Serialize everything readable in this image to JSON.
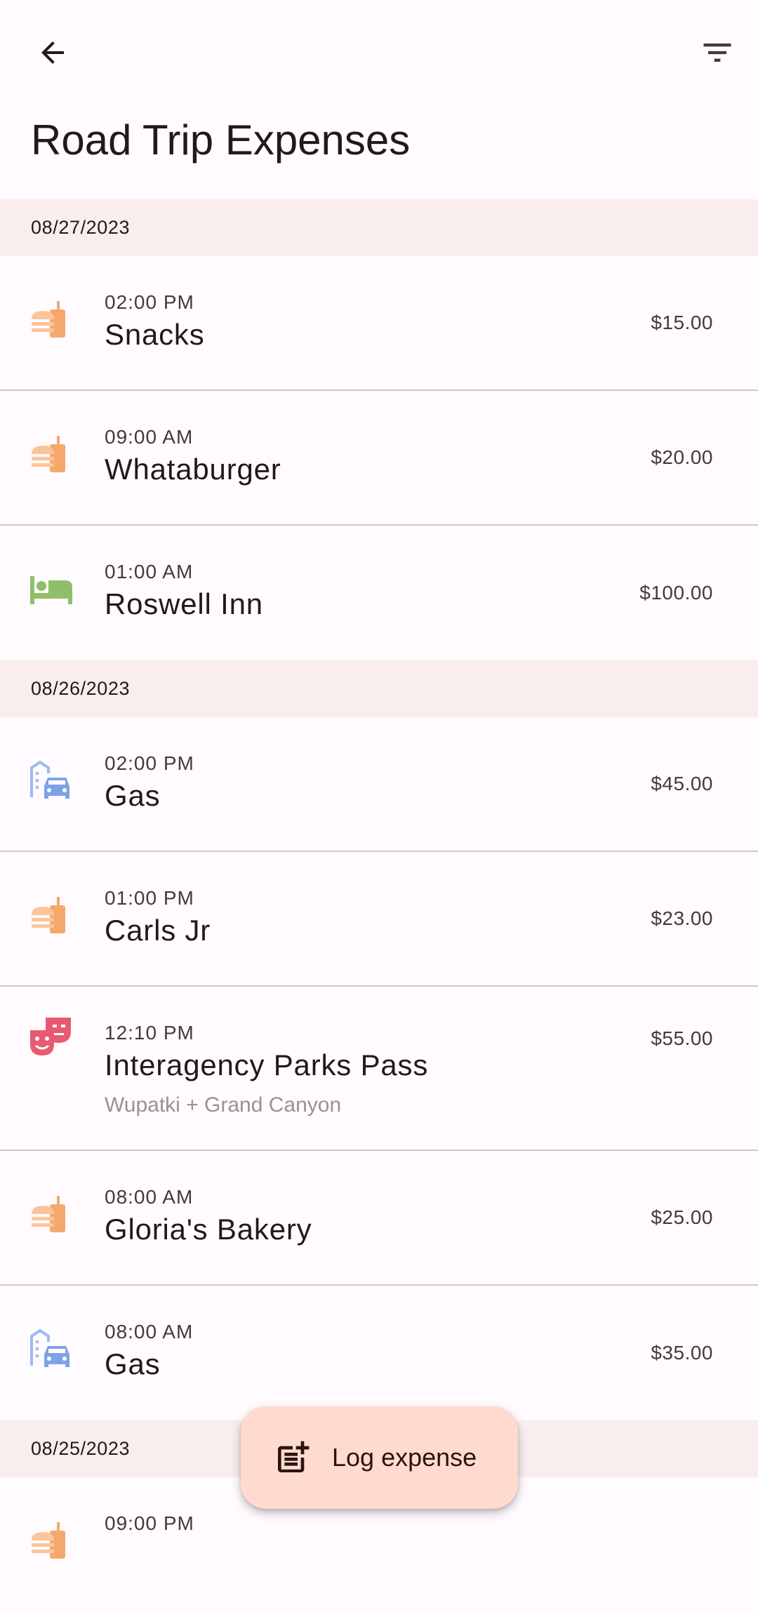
{
  "header": {
    "title": "Road Trip Expenses",
    "back_icon": "arrow-back-icon",
    "filter_icon": "filter-list-icon"
  },
  "colors": {
    "food": "#f5a86c",
    "lodging": "#8fbf6a",
    "transport": "#7ca3e6",
    "entertainment": "#e85a70",
    "fab_background": "#ffdbcf",
    "date_header_background": "#f9eeed"
  },
  "groups": [
    {
      "date": "08/27/2023",
      "items": [
        {
          "time": "02:00 PM",
          "title": "Snacks",
          "subtitle": "",
          "amount": "$15.00",
          "category": "food",
          "icon": "fastfood-icon"
        },
        {
          "time": "09:00 AM",
          "title": "Whataburger",
          "subtitle": "",
          "amount": "$20.00",
          "category": "food",
          "icon": "fastfood-icon"
        },
        {
          "time": "01:00 AM",
          "title": "Roswell Inn",
          "subtitle": "",
          "amount": "$100.00",
          "category": "lodging",
          "icon": "hotel-bed-icon"
        }
      ]
    },
    {
      "date": "08/26/2023",
      "items": [
        {
          "time": "02:00 PM",
          "title": "Gas",
          "subtitle": "",
          "amount": "$45.00",
          "category": "transport",
          "icon": "commute-car-icon"
        },
        {
          "time": "01:00 PM",
          "title": "Carls Jr",
          "subtitle": "",
          "amount": "$23.00",
          "category": "food",
          "icon": "fastfood-icon"
        },
        {
          "time": "12:10 PM",
          "title": "Interagency Parks Pass",
          "subtitle": "Wupatki + Grand Canyon",
          "amount": "$55.00",
          "category": "entertainment",
          "icon": "theater-masks-icon"
        },
        {
          "time": "08:00 AM",
          "title": "Gloria's Bakery",
          "subtitle": "",
          "amount": "$25.00",
          "category": "food",
          "icon": "fastfood-icon"
        },
        {
          "time": "08:00 AM",
          "title": "Gas",
          "subtitle": "",
          "amount": "$35.00",
          "category": "transport",
          "icon": "commute-car-icon"
        }
      ]
    },
    {
      "date": "08/25/2023",
      "items": [
        {
          "time": "09:00 PM",
          "title": "",
          "subtitle": "",
          "amount": "",
          "category": "food",
          "icon": "fastfood-icon"
        }
      ]
    }
  ],
  "fab": {
    "label": "Log expense",
    "icon": "post-add-icon"
  }
}
